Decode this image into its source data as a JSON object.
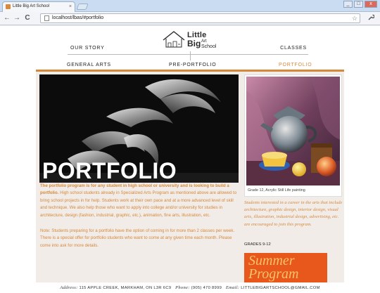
{
  "browser": {
    "tab_title": "Little Big Art School",
    "tab_close": "×",
    "url": "localhost/lbas/#portfolio",
    "back": "←",
    "forward": "→",
    "reload": "C",
    "star": "☆",
    "menu": "🔧",
    "window_buttons": [
      "_",
      "□",
      "x"
    ]
  },
  "logo": {
    "little": "Little",
    "big": "Big",
    "art": "Art",
    "school": "School"
  },
  "nav": {
    "top_left": "OUR STORY",
    "top_right": "CLASSES",
    "bottom": [
      "GENERAL ARTS",
      "PRE-PORTFOLIO",
      "PORTFOLIO"
    ],
    "active": "PORTFOLIO"
  },
  "hero": {
    "title": "PORTFOLIO"
  },
  "description": {
    "bold_lead": "The portfolio program is for any student in high school or university and is looking to build a portfolio.",
    "body": " High school students already in Specialized Arts Program as mentioned above are allowed to bring school projects in for help. Students work at their own pace and at a more advanced level of skill and technique. We also help those who want to apply into college and/or university for studies in architecture, design (fashion, industrial, graphic, etc.), animation, fine arts, illustration, etc.",
    "note": "Note: Students preparing for a portfolio have the option of coming in for more than 2 classes per week. There is a special offer for portfolio students who want to come at any given time each month. Please come into ask for more details."
  },
  "sidebar": {
    "caption": "Grade 12, Acrylic Still Life painting",
    "text": "Students interested in a career in the arts that include architecture, graphic design, interior design, visual arts, illustration, industrial design, advertising, etc. are encouraged to join this program.",
    "grades": "GRADES 9-12",
    "promo_line1": "Summer",
    "promo_line2": "Program"
  },
  "footer": {
    "address_label": "Address:",
    "address": "115 APPLE CREEK, MARKHAM, ON L3R 6C9",
    "phone_label": "Phone:",
    "phone": "(905) 470 8999",
    "email_label": "Email:",
    "email": "LITTLEBIGARTSCHOOL@GMAIL.COM"
  },
  "colors": {
    "accent": "#d4883a",
    "content_bg": "#f2ece8",
    "promo_bg": "#e8571b"
  }
}
